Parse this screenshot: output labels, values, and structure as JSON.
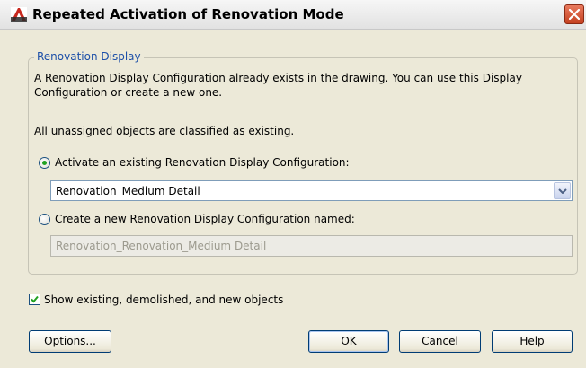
{
  "window": {
    "title": "Repeated Activation of Renovation Mode",
    "icon": "autocad-app-icon"
  },
  "group": {
    "legend": "Renovation Display",
    "description_line1": "A Renovation Display Configuration already exists in the drawing. You can use this Display",
    "description_line2": "Configuration or create a new one.",
    "classified_note": "All unassigned objects are classified as existing.",
    "option_existing": {
      "label": "Activate an existing Renovation Display Configuration:",
      "selected": true,
      "dropdown_value": "Renovation_Medium Detail"
    },
    "option_new": {
      "label": "Create a new Renovation Display Configuration named:",
      "selected": false,
      "field_value": "Renovation_Renovation_Medium Detail"
    }
  },
  "show_objects": {
    "label": "Show existing, demolished, and new objects",
    "checked": true
  },
  "buttons": {
    "options": "Options...",
    "ok": "OK",
    "cancel": "Cancel",
    "help": "Help"
  },
  "colors": {
    "dialog_bg": "#ece9d8",
    "legend_blue": "#1c4fa8",
    "close_red": "#c4401f",
    "radio_green": "#21a121"
  }
}
